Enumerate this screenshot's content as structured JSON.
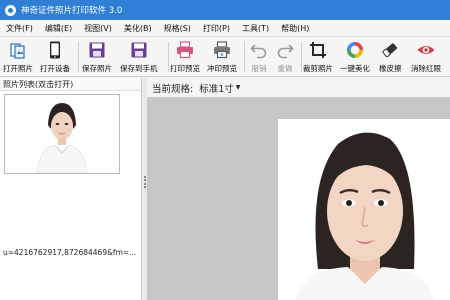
{
  "window": {
    "title": "神奇证件照片打印软件 3.0"
  },
  "menu": [
    "文件(F)",
    "编辑(E)",
    "视图(V)",
    "美化(B)",
    "规格(S)",
    "打印(P)",
    "工具(T)",
    "帮助(H)"
  ],
  "toolbar": {
    "open_photo": "打开照片",
    "open_device": "打开设备",
    "save_photo": "保存照片",
    "save_to_phone": "保存到手机",
    "print_preview": "打印预览",
    "wash_preview": "冲印预览",
    "undo": "撤销",
    "redo": "重做",
    "crop_photo": "裁剪照片",
    "one_click_beautify": "一键美化",
    "eraser": "橡皮擦",
    "remove_red_eye": "消除红眼"
  },
  "left_panel": {
    "title": "照片列表(双击打开)",
    "filename": "u=4216762917,872684469&fm=..."
  },
  "main": {
    "spec_label": "当前规格:",
    "spec_value": "标准1寸"
  },
  "colors": {
    "titlebar": "#2f7fd6",
    "save_purple": "#6a3f8f",
    "print_pink": "#d6577e",
    "crop_dark": "#2b2b2b",
    "eraser_dark": "#333333",
    "redeye_red": "#d23b4b"
  }
}
